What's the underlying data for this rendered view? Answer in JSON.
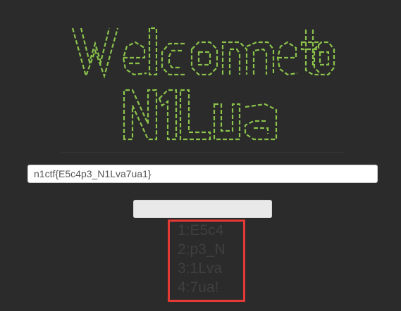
{
  "banner": {
    "line1": "Welcome to",
    "line2": "N1Lua",
    "color": "#8bc34a"
  },
  "flag_field": {
    "value": "n1ctf{E5c4p3_N1Lva7ua1}"
  },
  "submit": {
    "label": ""
  },
  "results": [
    "1:E5c4",
    "2:p3_N",
    "3:1Lva",
    "4:7ua!"
  ],
  "colors": {
    "background": "#2b2b2b",
    "banner_text": "#8bc34a",
    "highlight_border": "#e53935",
    "result_text": "#3f3f3f"
  }
}
